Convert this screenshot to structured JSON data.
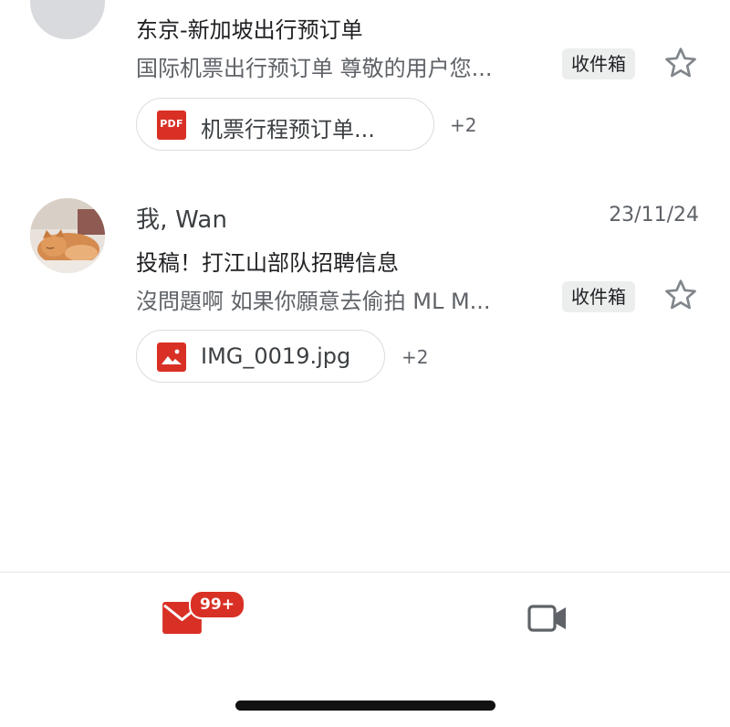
{
  "emails": [
    {
      "sender": "",
      "date": "",
      "subject": "东京-新加坡出行预订单",
      "snippet": "国际机票出行预订单 尊敬的用户您...",
      "label": "收件箱",
      "attachment": {
        "icon": "pdf-icon",
        "icon_text": "PDF",
        "name": "机票行程预订单...",
        "more": "+2"
      },
      "starred": false
    },
    {
      "sender": "我, Wan",
      "date": "23/11/24",
      "subject": "投稿！打江山部队招聘信息",
      "snippet": "沒問題啊 如果你願意去偷拍 ML M...",
      "label": "收件箱",
      "attachment": {
        "icon": "image-icon",
        "name": "IMG_0019.jpg",
        "more": "+2"
      },
      "starred": false
    }
  ],
  "bottom_nav": {
    "mail_badge": "99+",
    "items": [
      {
        "icon": "mail-icon"
      },
      {
        "icon": "video-camera-icon"
      }
    ]
  },
  "colors": {
    "accent_red": "#d93025",
    "label_bg": "#eceded",
    "text_secondary": "#5f6368"
  }
}
